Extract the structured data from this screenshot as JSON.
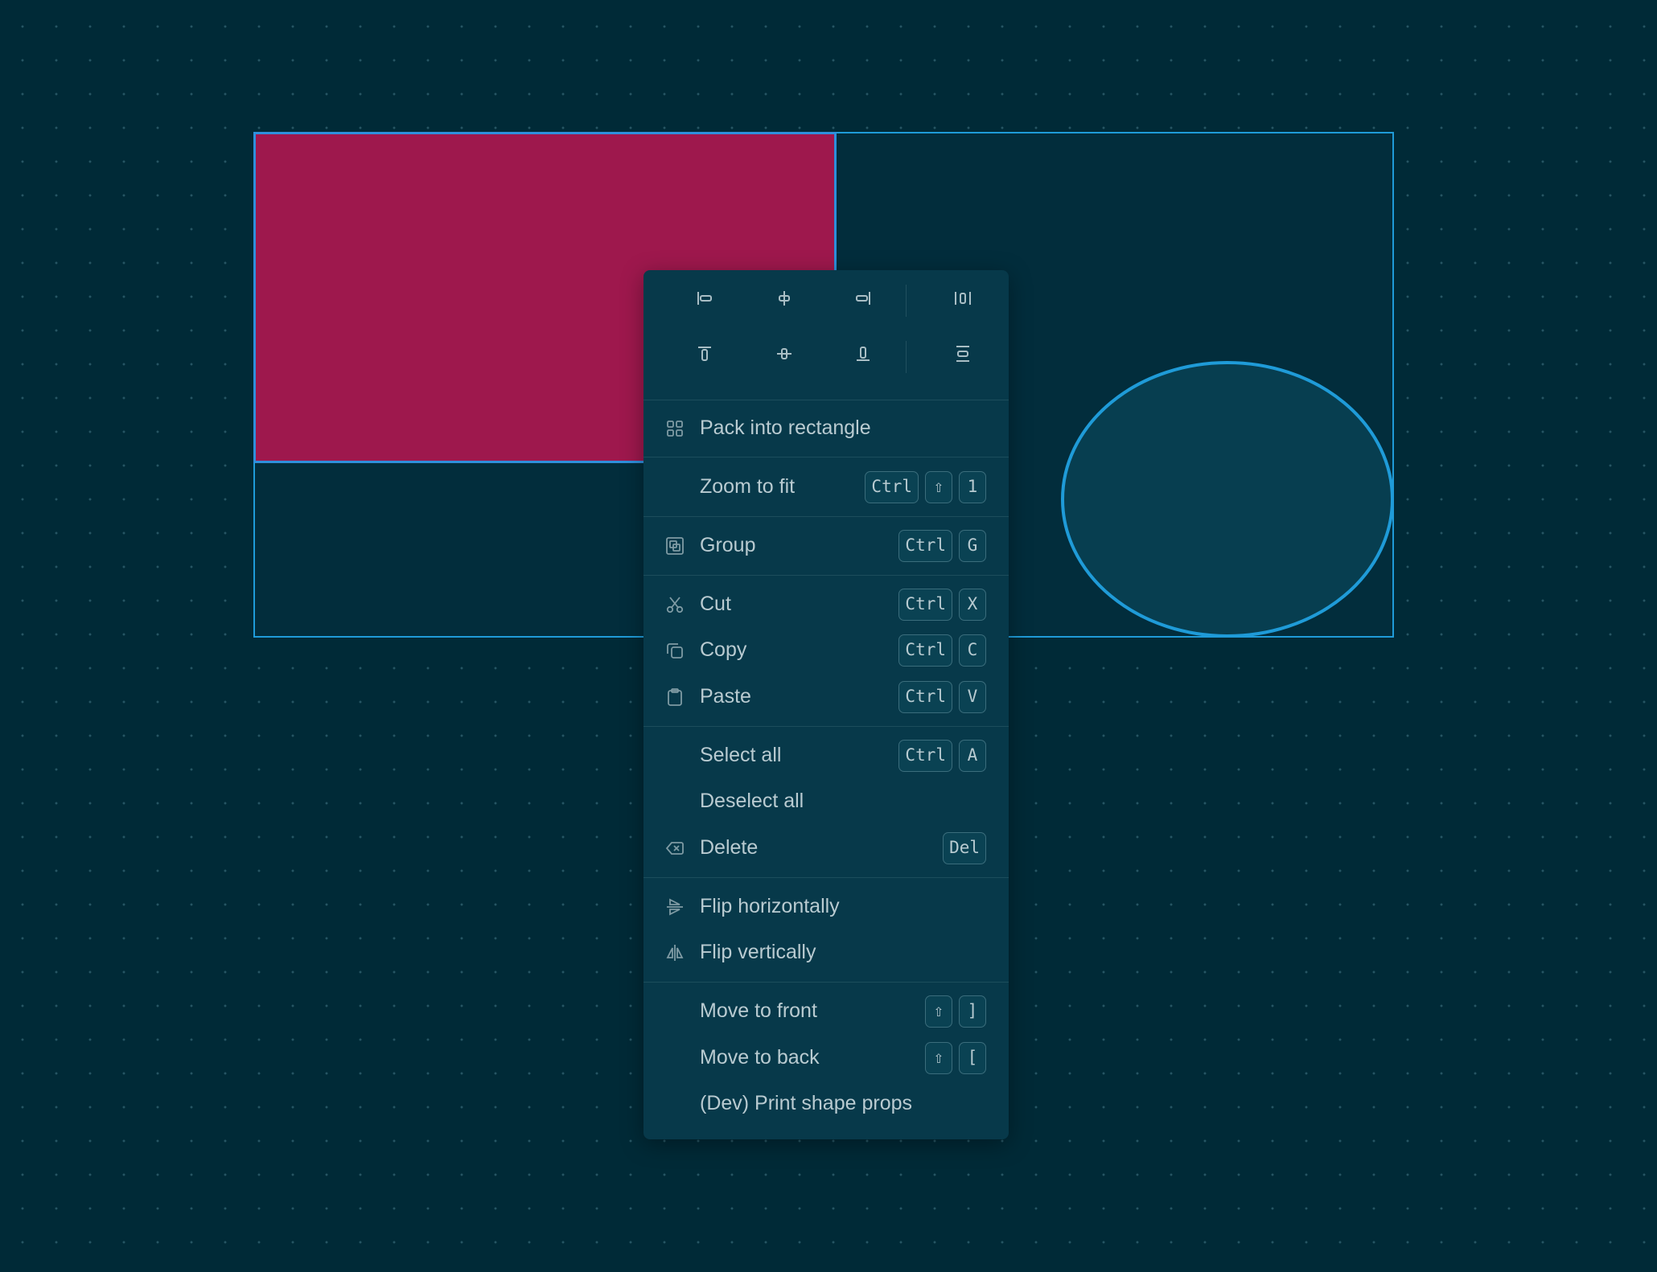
{
  "colors": {
    "canvas_bg": "#002a37",
    "selection": "#1f9bd8",
    "rectangle_fill": "#9e184d",
    "ellipse_fill": "#073e50",
    "menu_bg": "#07394a"
  },
  "align_tools": [
    {
      "icon": "align-left-icon"
    },
    {
      "icon": "align-center-horizontal-icon"
    },
    {
      "icon": "align-right-icon"
    },
    {
      "icon": "distribute-horizontal-icon"
    },
    {
      "icon": "align-top-icon"
    },
    {
      "icon": "align-center-vertical-icon"
    },
    {
      "icon": "align-bottom-icon"
    },
    {
      "icon": "distribute-vertical-icon"
    }
  ],
  "menu": {
    "pack": {
      "label": "Pack into rectangle",
      "icon": "pack-grid-icon"
    },
    "zoom": {
      "label": "Zoom to fit",
      "keys": [
        "Ctrl",
        "⇧",
        "1"
      ]
    },
    "group": {
      "label": "Group",
      "icon": "group-icon",
      "keys": [
        "Ctrl",
        "G"
      ]
    },
    "cut": {
      "label": "Cut",
      "icon": "scissors-icon",
      "keys": [
        "Ctrl",
        "X"
      ]
    },
    "copy": {
      "label": "Copy",
      "icon": "copy-icon",
      "keys": [
        "Ctrl",
        "C"
      ]
    },
    "paste": {
      "label": "Paste",
      "icon": "clipboard-icon",
      "keys": [
        "Ctrl",
        "V"
      ]
    },
    "select_all": {
      "label": "Select all",
      "keys": [
        "Ctrl",
        "A"
      ]
    },
    "deselect_all": {
      "label": "Deselect all"
    },
    "delete": {
      "label": "Delete",
      "icon": "backspace-icon",
      "keys": [
        "Del"
      ]
    },
    "flip_h": {
      "label": "Flip horizontally",
      "icon": "flip-horizontal-icon"
    },
    "flip_v": {
      "label": "Flip vertically",
      "icon": "flip-vertical-icon"
    },
    "front": {
      "label": "Move to front",
      "keys": [
        "⇧",
        "]"
      ]
    },
    "back": {
      "label": "Move to back",
      "keys": [
        "⇧",
        "["
      ]
    },
    "dev": {
      "label": "(Dev) Print shape props"
    }
  }
}
